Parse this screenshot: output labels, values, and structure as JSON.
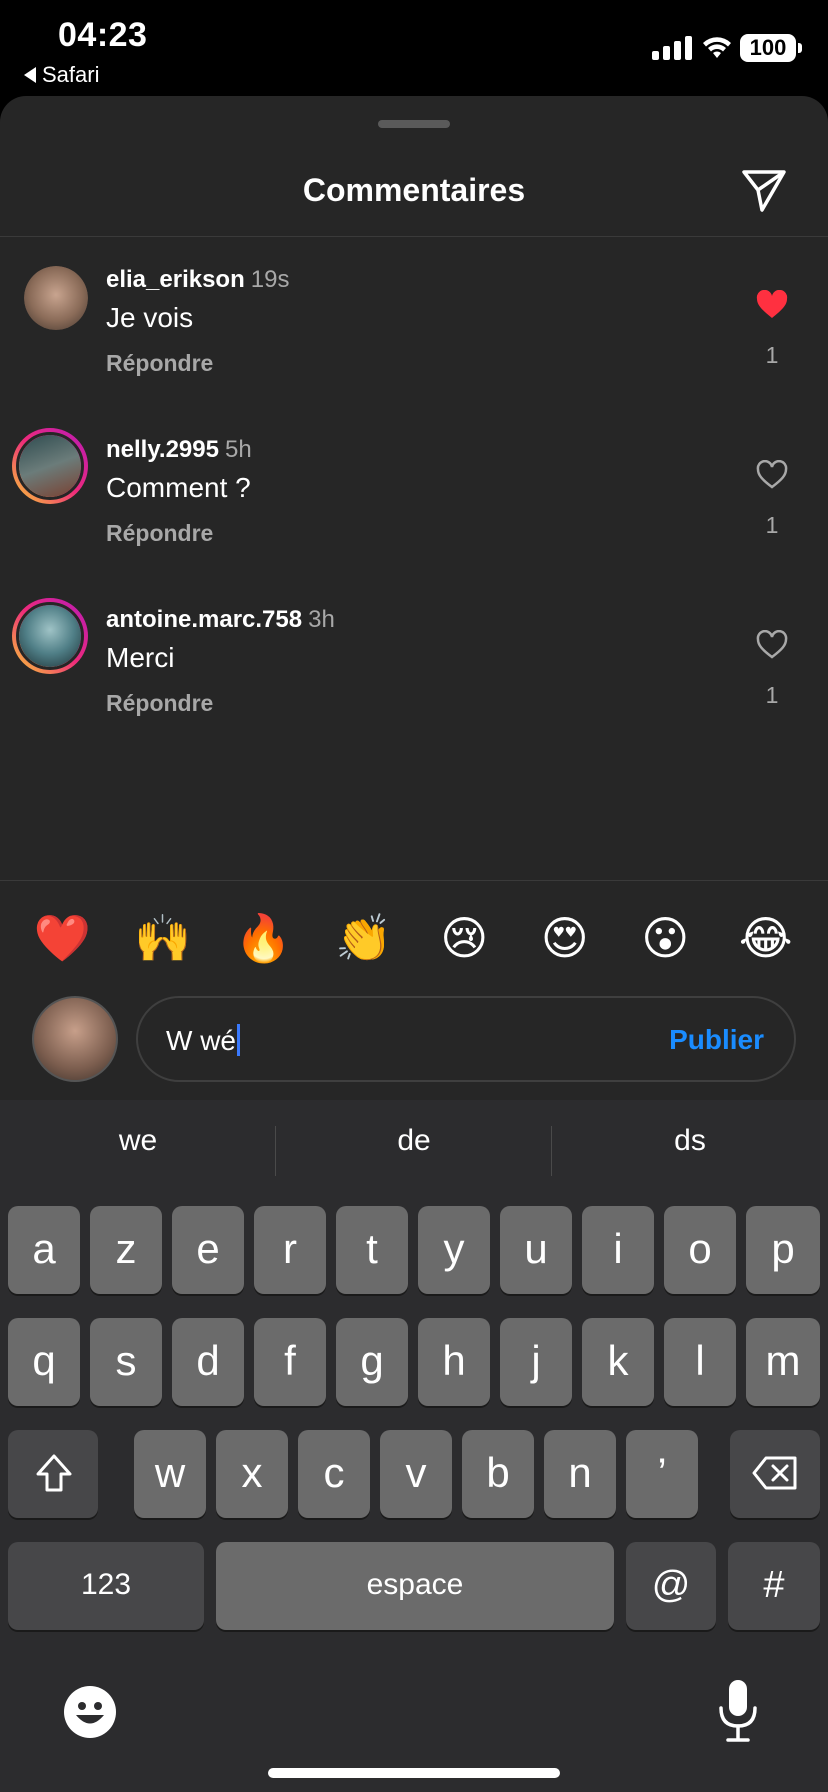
{
  "status": {
    "time": "04:23",
    "back_app": "Safari",
    "battery": "100"
  },
  "sheet": {
    "title": "Commentaires"
  },
  "comments": [
    {
      "username": "elia_erikson",
      "time": "19s",
      "text": "Je vois",
      "reply": "Répondre",
      "likes": "1",
      "liked": true
    },
    {
      "username": "nelly.2995",
      "time": "5h",
      "text": "Comment ?",
      "reply": "Répondre",
      "likes": "1",
      "liked": false
    },
    {
      "username": "antoine.marc.758",
      "time": "3h",
      "text": "Merci",
      "reply": "Répondre",
      "likes": "1",
      "liked": false
    }
  ],
  "reactions": [
    "❤️",
    "🙌",
    "🔥",
    "👏",
    "😢",
    "😍",
    "😮",
    "😂"
  ],
  "composer": {
    "value": "W wé",
    "publish": "Publier"
  },
  "keyboard": {
    "suggestions": [
      "we",
      "de",
      "ds"
    ],
    "row1": [
      "a",
      "z",
      "e",
      "r",
      "t",
      "y",
      "u",
      "i",
      "o",
      "p"
    ],
    "row2": [
      "q",
      "s",
      "d",
      "f",
      "g",
      "h",
      "j",
      "k",
      "l",
      "m"
    ],
    "row3": [
      "w",
      "x",
      "c",
      "v",
      "b",
      "n",
      "’"
    ],
    "numbers": "123",
    "space": "espace",
    "at": "@",
    "hash": "#"
  },
  "colors": {
    "accent": "#1a8cff",
    "like": "#ff3040",
    "sheet": "#262626"
  }
}
